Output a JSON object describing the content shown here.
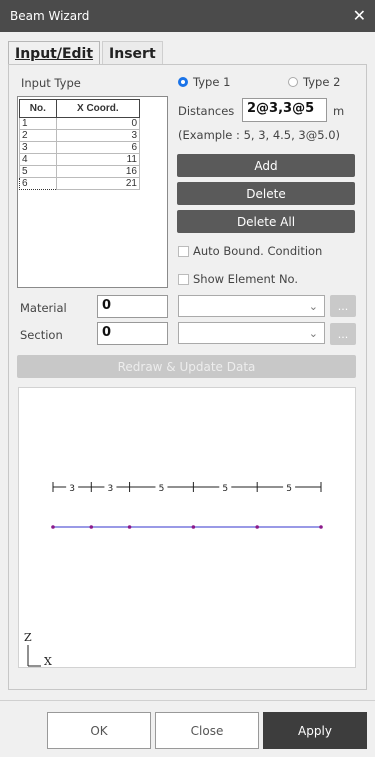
{
  "window": {
    "title": "Beam Wizard"
  },
  "tabs": [
    {
      "label": "Input/Edit"
    },
    {
      "label": "Insert"
    }
  ],
  "input_type": {
    "label": "Input Type",
    "type1_label": "Type 1",
    "type2_label": "Type 2"
  },
  "grid": {
    "headers": [
      "No.",
      "X Coord."
    ],
    "rows": [
      {
        "no": "1",
        "x": "0"
      },
      {
        "no": "2",
        "x": "3"
      },
      {
        "no": "3",
        "x": "6"
      },
      {
        "no": "4",
        "x": "11"
      },
      {
        "no": "5",
        "x": "16"
      },
      {
        "no": "6",
        "x": "21"
      }
    ]
  },
  "distances": {
    "label": "Distances",
    "value": "2@3,3@5",
    "unit": "m",
    "example": "(Example : 5, 3, 4.5, 3@5.0)"
  },
  "buttons": {
    "add": "Add",
    "delete": "Delete",
    "delete_all": "Delete All",
    "redraw": "Redraw & Update Data",
    "ok": "OK",
    "close": "Close",
    "apply": "Apply",
    "more": "..."
  },
  "checkboxes": {
    "auto_bound": "Auto Bound. Condition",
    "show_element": "Show Element No."
  },
  "material": {
    "label": "Material",
    "value": "0"
  },
  "section": {
    "label": "Section",
    "value": "0"
  },
  "preview": {
    "spans": [
      "3",
      "3",
      "5",
      "5",
      "5"
    ],
    "node_positions": [
      0,
      3,
      6,
      11,
      16,
      21
    ],
    "axis_z": "Z",
    "axis_x": "X",
    "colors": {
      "beam": "#3333cc",
      "node": "#8b1a8b",
      "dim": "#222222"
    }
  }
}
